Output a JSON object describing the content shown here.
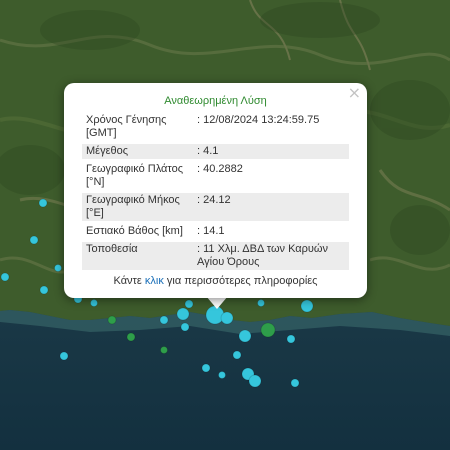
{
  "popup": {
    "title": "Αναθεωρημένη Λύση",
    "close_label": "×",
    "rows": [
      {
        "label": "Χρόνος Γένησης [GMT]",
        "value": ": 12/08/2024 13:24:59.75"
      },
      {
        "label": "Μέγεθος",
        "value": ": 4.1"
      },
      {
        "label": "Γεωγραφικό Πλάτος [°N]",
        "value": ": 40.2882"
      },
      {
        "label": "Γεωγραφικό Μήκος [°E]",
        "value": ": 24.12"
      },
      {
        "label": "Εστιακό Βάθος [km]",
        "value": ": 14.1"
      },
      {
        "label": "Τοποθεσία",
        "value": ": 11 Χλμ. ΔΒΔ των Καρυών Αγίου Όρους"
      }
    ],
    "footer_prefix": "Κάντε ",
    "footer_link": "κλικ",
    "footer_suffix": " για περισσότερες πληροφορίες"
  },
  "colors": {
    "title_green": "#2f8a2f",
    "link_blue": "#1a6fb8",
    "marker_cyan": "#35c6dc",
    "marker_green": "#2e9e4a",
    "sea": "#1d3a4a",
    "land": "#3f5f2e"
  }
}
